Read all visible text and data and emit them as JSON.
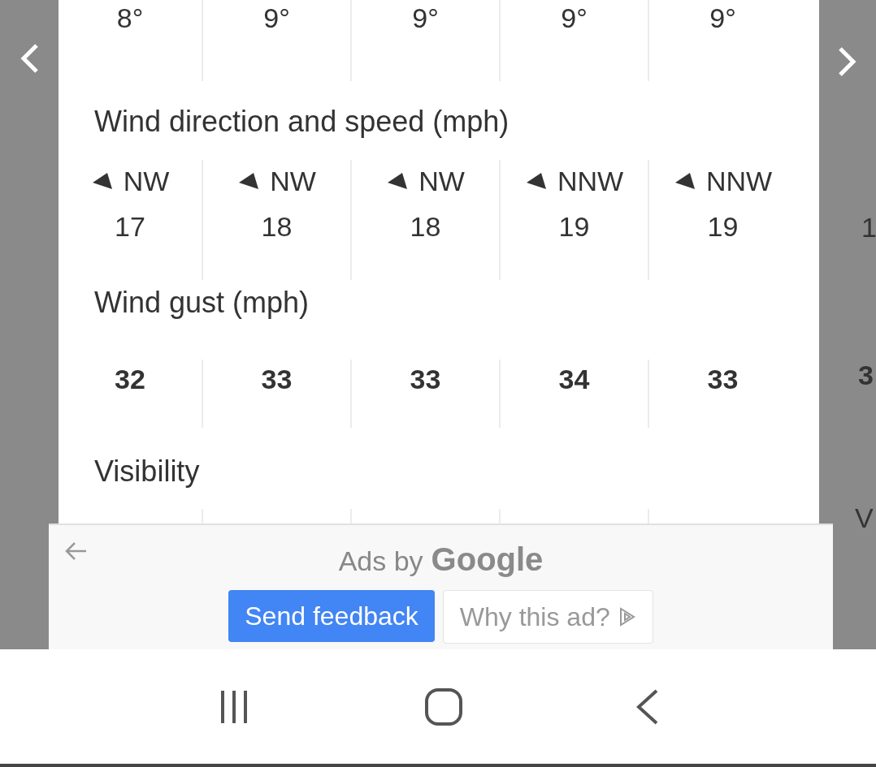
{
  "temperatures": [
    "8°",
    "9°",
    "9°",
    "9°",
    "9°"
  ],
  "wind_heading": "Wind direction and speed (mph)",
  "wind": [
    {
      "direction": "NW",
      "speed": "17"
    },
    {
      "direction": "NW",
      "speed": "18"
    },
    {
      "direction": "NW",
      "speed": "18"
    },
    {
      "direction": "NNW",
      "speed": "19"
    },
    {
      "direction": "NNW",
      "speed": "19"
    }
  ],
  "gust_heading": "Wind gust (mph)",
  "gusts": [
    "32",
    "33",
    "33",
    "34",
    "33"
  ],
  "visibility_heading": "Visibility",
  "next_column": {
    "speed": "1",
    "gust": "3",
    "visibility": "V"
  },
  "ad": {
    "label": "Ads by",
    "brand": "Google",
    "send_feedback": "Send feedback",
    "why": "Why this ad?"
  }
}
